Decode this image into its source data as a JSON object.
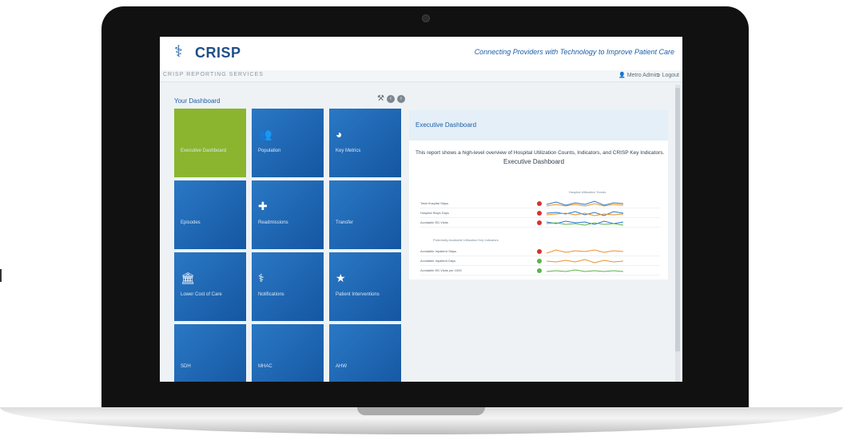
{
  "header": {
    "logo": "CRISP",
    "tagline": "Connecting Providers with Technology to Improve Patient Care",
    "subbar_title": "CRISP REPORTING SERVICES",
    "user": "Metro Admin",
    "logout": "Logout"
  },
  "dashboard": {
    "title": "Your Dashboard",
    "tiles": [
      {
        "label": "Executive Dashboard",
        "icon": "chart-icon"
      },
      {
        "label": "Population",
        "icon": "people-icon"
      },
      {
        "label": "Key Metrics",
        "icon": "gauge-icon"
      },
      {
        "label": "Episodes",
        "icon": ""
      },
      {
        "label": "Readmissions",
        "icon": "medkit-icon"
      },
      {
        "label": "Transfer",
        "icon": ""
      },
      {
        "label": "Lower Cost of Care",
        "icon": "bank-icon"
      },
      {
        "label": "Notifications",
        "icon": "doctor-icon"
      },
      {
        "label": "Patient Interventions",
        "icon": "network-icon"
      },
      {
        "label": "SDH",
        "icon": ""
      },
      {
        "label": "MHAC",
        "icon": ""
      },
      {
        "label": "AHW",
        "icon": ""
      }
    ]
  },
  "panel": {
    "title": "Executive Dashboard",
    "description": "This report shows a high-level overview of Hospital Utilization Counts, Indicators, and CRISP Key Indicators.",
    "sub_title": "Executive Dashboard",
    "trend_title": "Hospital Utilization Trends",
    "key_title": "Potentially Avoidable Utilization Key Indicators",
    "rows1": [
      {
        "name": "Total Hospital Stays"
      },
      {
        "name": "Hospital Stays Days"
      },
      {
        "name": "Avoidable ED Visits"
      }
    ],
    "rows2": [
      {
        "name": "Avoidable Inpatient Stays"
      },
      {
        "name": "Avoidable Inpatient Days"
      },
      {
        "name": "Avoidable ED Visits per 1000"
      }
    ]
  },
  "colors": {
    "accent": "#1f5fa6",
    "active_tile": "#8bb52f",
    "tile": "#1a64b0"
  }
}
